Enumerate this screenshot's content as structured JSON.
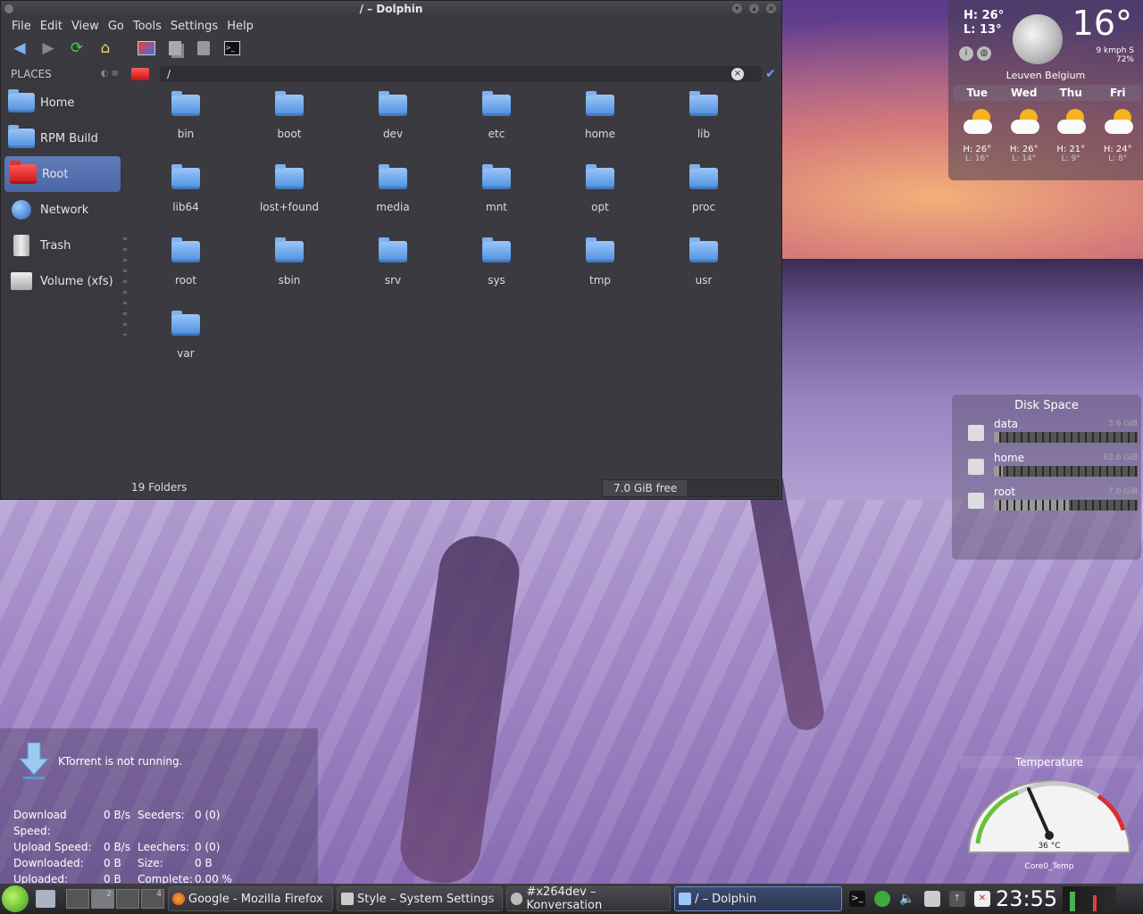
{
  "window": {
    "title": "/ – Dolphin"
  },
  "menu": [
    "File",
    "Edit",
    "View",
    "Go",
    "Tools",
    "Settings",
    "Help"
  ],
  "toolbar_icons": [
    "back-arrow-icon",
    "forward-arrow-icon",
    "reload-icon",
    "home-icon",
    "view-icon",
    "copy-icon",
    "paste-icon",
    "terminal-icon"
  ],
  "places": {
    "heading": "PLACES",
    "items": [
      {
        "label": "Home",
        "icon": "home-folder-icon"
      },
      {
        "label": "RPM Build",
        "icon": "folder-icon"
      },
      {
        "label": "Root",
        "icon": "root-folder-icon"
      },
      {
        "label": "Network",
        "icon": "network-globe-icon"
      },
      {
        "label": "Trash",
        "icon": "trash-icon"
      },
      {
        "label": "Volume (xfs)",
        "icon": "drive-icon"
      }
    ]
  },
  "address": {
    "path": "/"
  },
  "folders": [
    "bin",
    "boot",
    "dev",
    "etc",
    "home",
    "lib",
    "lib64",
    "lost+found",
    "media",
    "mnt",
    "opt",
    "proc",
    "root",
    "sbin",
    "srv",
    "sys",
    "tmp",
    "usr",
    "var"
  ],
  "status": {
    "count": "19 Folders",
    "free": "7.0 GiB free",
    "free_used_fraction": 0.48
  },
  "weather": {
    "high": "H: 26°",
    "low": "L: 13°",
    "temp": "16°",
    "wind": "9 kmph S",
    "humidity": "72%",
    "location": "Leuven Belgium",
    "days": [
      {
        "day": "Tue",
        "high": "H: 26°",
        "low": "L: 16°"
      },
      {
        "day": "Wed",
        "high": "H: 26°",
        "low": "L: 14°"
      },
      {
        "day": "Thu",
        "high": "H: 21°",
        "low": "L: 9°"
      },
      {
        "day": "Fri",
        "high": "H: 24°",
        "low": "L: 8°"
      }
    ]
  },
  "disk": {
    "title": "Disk Space",
    "drives": [
      {
        "name": "data",
        "size": "3.6 GiB",
        "used_fraction": 0.04
      },
      {
        "name": "home",
        "size": "82.6 GiB",
        "used_fraction": 0.06
      },
      {
        "name": "root",
        "size": "7.0 GiB",
        "used_fraction": 0.52
      }
    ]
  },
  "temperature": {
    "title": "Temperature",
    "value": "36 °C",
    "sensor": "Core0_Temp"
  },
  "ktorrent": {
    "message": "KTorrent is not running.",
    "rows": [
      [
        "Download Speed:",
        "0 B/s",
        "Seeders:",
        "0 (0)"
      ],
      [
        "Upload Speed:",
        "0 B/s",
        "Leechers:",
        "0 (0)"
      ],
      [
        "Downloaded:",
        "0 B",
        "Size:",
        "0 B"
      ],
      [
        "Uploaded:",
        "0 B",
        "Complete:",
        "0.00 %"
      ]
    ]
  },
  "taskbar": {
    "pager": [
      "2",
      "4"
    ],
    "tasks": [
      {
        "label": "Google - Mozilla Firefox",
        "width": 185
      },
      {
        "label": "Style – System Settings",
        "width": 186
      },
      {
        "label": "#x264dev – Konversation",
        "width": 184
      },
      {
        "label": "/ – Dolphin",
        "width": 188
      }
    ],
    "clock": "23:55"
  }
}
